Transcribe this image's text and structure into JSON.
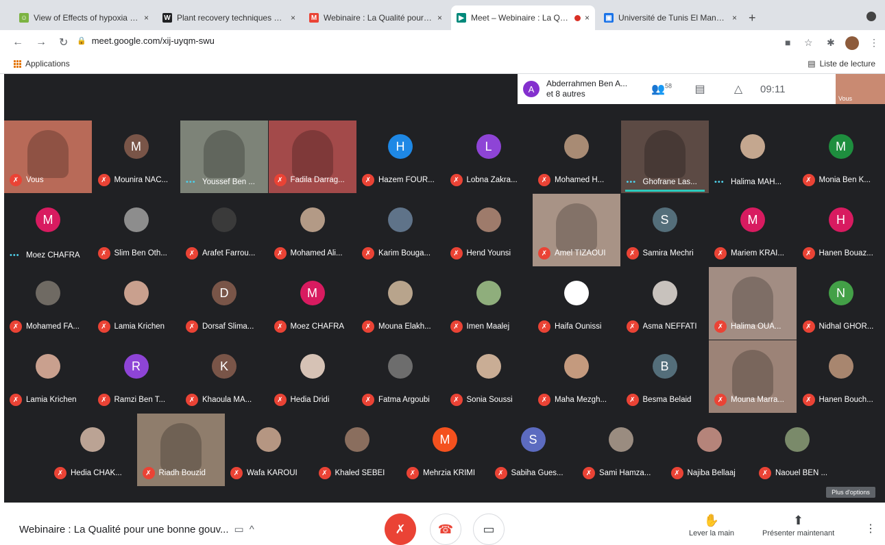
{
  "tabs": [
    {
      "title": "View of Effects of hypoxia on …",
      "color": "#7cb342",
      "glyph": "☺",
      "active": false,
      "recording": false
    },
    {
      "title": "Plant recovery techniques do…",
      "color": "#202124",
      "glyph": "W",
      "active": false,
      "recording": false
    },
    {
      "title": "Webinaire : La Qualité pour un…",
      "color": "#ea4335",
      "glyph": "M",
      "active": false,
      "recording": false
    },
    {
      "title": "Meet – Webinaire : La Qual",
      "color": "#00897b",
      "glyph": "▶",
      "active": true,
      "recording": true
    },
    {
      "title": "Université de Tunis El Manar –",
      "color": "#1a73e8",
      "glyph": "▣",
      "active": false,
      "recording": false
    }
  ],
  "address": {
    "url": "meet.google.com/xij-uyqm-swu"
  },
  "bookmarks": {
    "apps_label": "Applications",
    "reading_list": "Liste de lecture"
  },
  "meet_top": {
    "avatar_letter": "A",
    "presenter": "Abderrahmen Ben A...",
    "presenter_more": "et 8 autres",
    "participants_count": "58",
    "time": "09:11",
    "self_label": "Vous"
  },
  "colors": {
    "mic_off": "#ea4335",
    "meet_bg": "#202124",
    "highlight": "#2ccbbe"
  },
  "rows": [
    [
      {
        "name": "Vous",
        "type": "video",
        "bg": "#b86a58",
        "mic": "muted"
      },
      {
        "name": "Mounira NAC...",
        "type": "avatar",
        "letter": "M",
        "bg": "#795548",
        "mic": "muted"
      },
      {
        "name": "Youssef Ben ...",
        "type": "video",
        "bg": "#7d8378",
        "mic": "speaking"
      },
      {
        "name": "Fadila Darrag...",
        "type": "video",
        "bg": "#a34a4a",
        "mic": "muted"
      },
      {
        "name": "Hazem FOUR...",
        "type": "avatar",
        "letter": "H",
        "bg": "#1e88e5",
        "mic": "muted"
      },
      {
        "name": "Lobna Zakra...",
        "type": "avatar",
        "letter": "L",
        "bg": "#8e44d6",
        "mic": "muted"
      },
      {
        "name": "Mohamed H...",
        "type": "photo",
        "bg": "#a88b74",
        "mic": "muted"
      },
      {
        "name": "Ghofrane Las...",
        "type": "video",
        "bg": "#5c4a44",
        "mic": "speaking",
        "underline": true
      },
      {
        "name": "Halima MAH...",
        "type": "photo",
        "bg": "#c4a78f",
        "mic": "speaking"
      },
      {
        "name": "Monia Ben K...",
        "type": "avatar",
        "letter": "M",
        "bg": "#1e8e3e",
        "mic": "muted"
      }
    ],
    [
      {
        "name": "Moez CHAFRA",
        "type": "avatar",
        "letter": "M",
        "bg": "#d81b60",
        "mic": "speaking"
      },
      {
        "name": "Slim Ben Oth...",
        "type": "photo",
        "bg": "#8d8d8d",
        "mic": "muted"
      },
      {
        "name": "Arafet Farrou...",
        "type": "photo",
        "bg": "#3a3a3a",
        "mic": "muted"
      },
      {
        "name": "Mohamed Ali...",
        "type": "photo",
        "bg": "#b39a86",
        "mic": "muted"
      },
      {
        "name": "Karim Bouga...",
        "type": "photo",
        "bg": "#5f7389",
        "mic": "muted"
      },
      {
        "name": "Hend Younsi",
        "type": "photo",
        "bg": "#9e7b6b",
        "mic": "muted"
      },
      {
        "name": "Amel TIZAOUI",
        "type": "video",
        "bg": "#a89386",
        "mic": "muted"
      },
      {
        "name": "Samira Mechri",
        "type": "avatar",
        "letter": "S",
        "bg": "#546e7a",
        "mic": "muted"
      },
      {
        "name": "Mariem KRAI...",
        "type": "avatar",
        "letter": "M",
        "bg": "#d81b60",
        "mic": "muted"
      },
      {
        "name": "Hanen Bouaz...",
        "type": "avatar",
        "letter": "H",
        "bg": "#d81b60",
        "mic": "muted"
      }
    ],
    [
      {
        "name": "Mohamed FA...",
        "type": "photo",
        "bg": "#6f6a63",
        "mic": "muted"
      },
      {
        "name": "Lamia Krichen",
        "type": "photo",
        "bg": "#c9a08e",
        "mic": "muted"
      },
      {
        "name": "Dorsaf Slima...",
        "type": "avatar",
        "letter": "D",
        "bg": "#795548",
        "mic": "muted"
      },
      {
        "name": "Moez CHAFRA",
        "type": "avatar",
        "letter": "M",
        "bg": "#d81b60",
        "mic": "muted"
      },
      {
        "name": "Mouna Elakh...",
        "type": "photo",
        "bg": "#b8a48c",
        "mic": "muted"
      },
      {
        "name": "Imen Maalej",
        "type": "photo",
        "bg": "#8fae7c",
        "mic": "muted"
      },
      {
        "name": "Haifa Ounissi",
        "type": "photo",
        "bg": "#ffffff",
        "mic": "muted"
      },
      {
        "name": "Asma NEFFATI",
        "type": "photo",
        "bg": "#c8c2bd",
        "mic": "muted"
      },
      {
        "name": "Halima OUA...",
        "type": "video",
        "bg": "#a28d83",
        "mic": "muted"
      },
      {
        "name": "Nidhal GHOR...",
        "type": "avatar",
        "letter": "N",
        "bg": "#43a047",
        "mic": "muted"
      }
    ],
    [
      {
        "name": "Lamia Krichen",
        "type": "photo",
        "bg": "#c9a08e",
        "mic": "muted"
      },
      {
        "name": "Ramzi Ben T...",
        "type": "avatar",
        "letter": "R",
        "bg": "#8e44d6",
        "mic": "muted"
      },
      {
        "name": "Khaoula MA...",
        "type": "avatar",
        "letter": "K",
        "bg": "#795548",
        "mic": "muted"
      },
      {
        "name": "Hedia Dridi",
        "type": "photo",
        "bg": "#d6c2b5",
        "mic": "muted"
      },
      {
        "name": "Fatma Argoubi",
        "type": "photo",
        "bg": "#6d6d6d",
        "mic": "muted"
      },
      {
        "name": "Sonia Soussi",
        "type": "photo",
        "bg": "#c9ad95",
        "mic": "muted"
      },
      {
        "name": "Maha Mezgh...",
        "type": "photo",
        "bg": "#c49a7e",
        "mic": "muted"
      },
      {
        "name": "Besma Belaid",
        "type": "avatar",
        "letter": "B",
        "bg": "#546e7a",
        "mic": "muted"
      },
      {
        "name": "Mouna Marra...",
        "type": "video",
        "bg": "#9c8377",
        "mic": "muted"
      },
      {
        "name": "Hanen Bouch...",
        "type": "photo",
        "bg": "#a8866f",
        "mic": "muted"
      }
    ],
    [
      {
        "name": "Hedia CHAK...",
        "type": "photo",
        "bg": "#bba394",
        "mic": "muted"
      },
      {
        "name": "Riadh Bouzid",
        "type": "video",
        "bg": "#8f7d6c",
        "mic": "muted"
      },
      {
        "name": "Wafa KAROUI",
        "type": "photo",
        "bg": "#b59682",
        "mic": "muted"
      },
      {
        "name": "Khaled SEBEI",
        "type": "photo",
        "bg": "#8a6e5e",
        "mic": "muted"
      },
      {
        "name": "Mehrzia KRIMI",
        "type": "avatar",
        "letter": "M",
        "bg": "#f4511e",
        "mic": "muted"
      },
      {
        "name": "Sabiha Gues...",
        "type": "avatar",
        "letter": "S",
        "bg": "#5c6bc0",
        "mic": "muted"
      },
      {
        "name": "Sami Hamza...",
        "type": "photo",
        "bg": "#9a8c80",
        "mic": "muted"
      },
      {
        "name": "Najiba Bellaaj",
        "type": "photo",
        "bg": "#b5847a",
        "mic": "muted"
      },
      {
        "name": "Naouel BEN ...",
        "type": "photo",
        "bg": "#7a8a6a",
        "mic": "muted"
      }
    ]
  ],
  "more_options": "Plus d'options",
  "bottom": {
    "meeting_title": "Webinaire : La Qualité pour une bonne gouv...",
    "raise_hand": "Lever la main",
    "present": "Présenter maintenant"
  }
}
